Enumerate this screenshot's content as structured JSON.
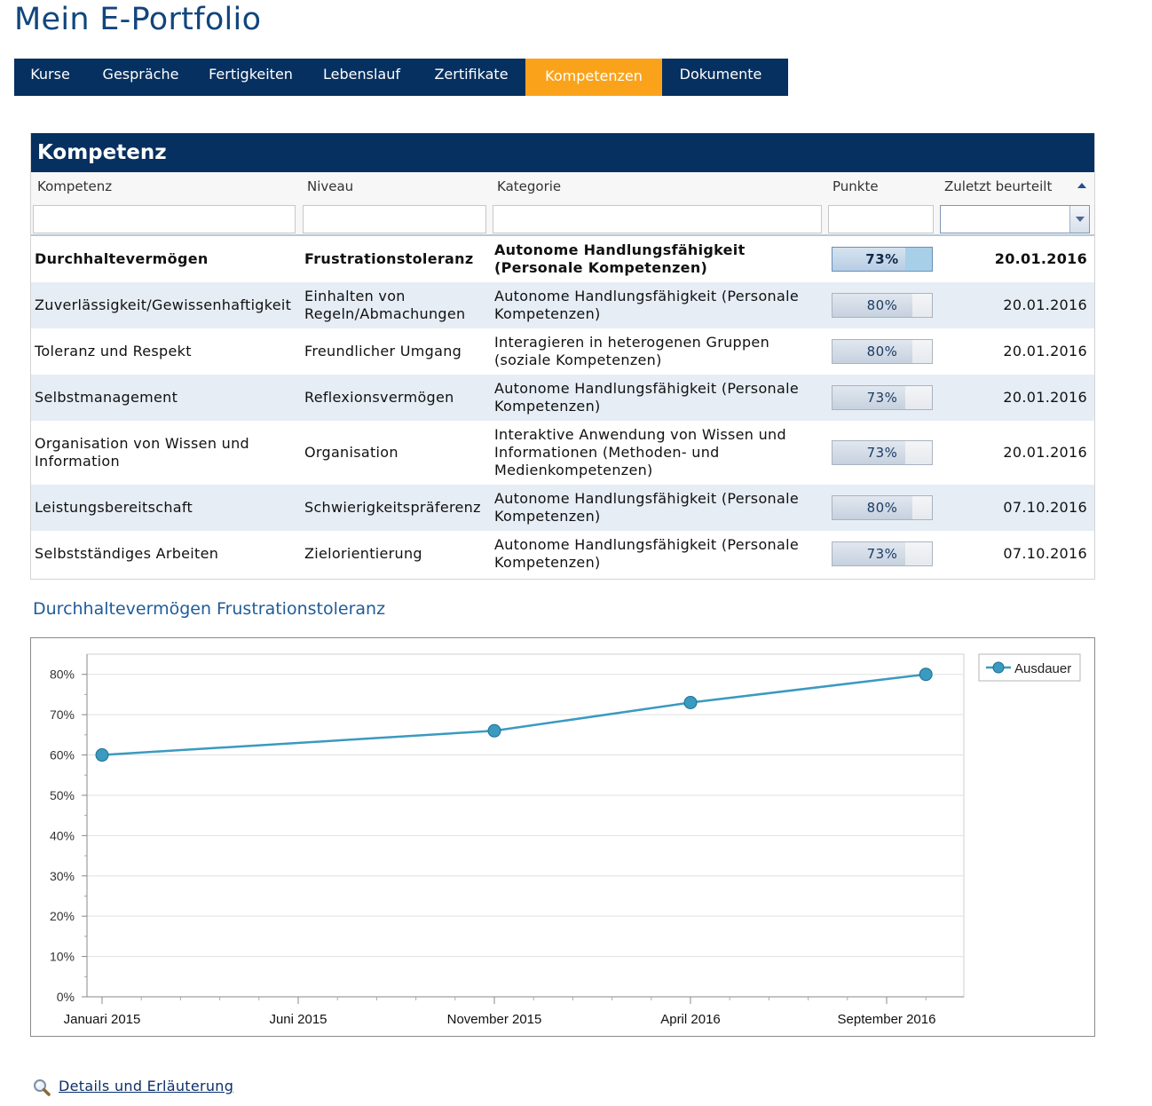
{
  "page": {
    "title": "Mein E-Portfolio"
  },
  "nav": {
    "tabs": [
      {
        "label": "Kurse",
        "active": false
      },
      {
        "label": "Gespräche",
        "active": false
      },
      {
        "label": "Fertigkeiten",
        "active": false
      },
      {
        "label": "Lebenslauf",
        "active": false
      },
      {
        "label": "Zertifikate",
        "active": false
      },
      {
        "label": "Kompetenzen",
        "active": true
      },
      {
        "label": "Dokumente",
        "active": false
      }
    ]
  },
  "grid": {
    "title": "Kompetenz",
    "columns": [
      "Kompetenz",
      "Niveau",
      "Kategorie",
      "Punkte",
      "Zuletzt beurteilt"
    ],
    "sort_column": "Zuletzt beurteilt",
    "sort_direction": "ascending",
    "filters": {
      "kompetenz": "",
      "niveau": "",
      "kategorie": "",
      "punkte": "",
      "datum": ""
    },
    "rows": [
      {
        "kompetenz": [
          "Durchhaltevermögen"
        ],
        "niveau": [
          "Frustrationstoleranz"
        ],
        "kategorie": [
          "Autonome Handlungsfähigkeit",
          "(Personale Kompetenzen)"
        ],
        "punkte": 73,
        "punkte_label": "73%",
        "datum": "20.01.2016",
        "selected": true
      },
      {
        "kompetenz": [
          "Zuverlässigkeit/Gewissenhaftigkeit"
        ],
        "niveau": [
          "Einhalten von",
          "Regeln/Abmachungen"
        ],
        "kategorie": [
          "Autonome Handlungsfähigkeit (Personale",
          "Kompetenzen)"
        ],
        "punkte": 80,
        "punkte_label": "80%",
        "datum": "20.01.2016",
        "selected": false
      },
      {
        "kompetenz": [
          "Toleranz und Respekt"
        ],
        "niveau": [
          "Freundlicher Umgang"
        ],
        "kategorie": [
          "Interagieren in heterogenen Gruppen",
          "(soziale Kompetenzen)"
        ],
        "punkte": 80,
        "punkte_label": "80%",
        "datum": "20.01.2016",
        "selected": false
      },
      {
        "kompetenz": [
          "Selbstmanagement"
        ],
        "niveau": [
          "Reflexionsvermögen"
        ],
        "kategorie": [
          "Autonome Handlungsfähigkeit (Personale",
          "Kompetenzen)"
        ],
        "punkte": 73,
        "punkte_label": "73%",
        "datum": "20.01.2016",
        "selected": false
      },
      {
        "kompetenz": [
          "Organisation von Wissen und",
          "Information"
        ],
        "niveau": [
          "Organisation"
        ],
        "kategorie": [
          "Interaktive Anwendung von Wissen und",
          "Informationen (Methoden- und",
          "Medienkompetenzen)"
        ],
        "punkte": 73,
        "punkte_label": "73%",
        "datum": "20.01.2016",
        "selected": false
      },
      {
        "kompetenz": [
          "Leistungsbereitschaft"
        ],
        "niveau": [
          "Schwierigkeitspräferenz"
        ],
        "kategorie": [
          "Autonome Handlungsfähigkeit (Personale",
          "Kompetenzen)"
        ],
        "punkte": 80,
        "punkte_label": "80%",
        "datum": "07.10.2016",
        "selected": false
      },
      {
        "kompetenz": [
          "Selbstständiges Arbeiten"
        ],
        "niveau": [
          "Zielorientierung"
        ],
        "kategorie": [
          "Autonome Handlungsfähigkeit (Personale",
          "Kompetenzen)"
        ],
        "punkte": 73,
        "punkte_label": "73%",
        "datum": "07.10.2016",
        "selected": false
      }
    ]
  },
  "chart_section": {
    "title": "Durchhaltevermögen Frustrationstoleranz"
  },
  "chart_data": {
    "type": "line",
    "title": "Durchhaltevermögen Frustrationstoleranz",
    "xlabel": "",
    "ylabel": "",
    "x_ticks": [
      "Januari 2015",
      "Juni 2015",
      "November 2015",
      "April 2016",
      "September 2016"
    ],
    "x_range": [
      "2015-01",
      "2016-10"
    ],
    "y_ticks": [
      "0%",
      "10%",
      "20%",
      "30%",
      "40%",
      "50%",
      "60%",
      "70%",
      "80%"
    ],
    "ylim": [
      0,
      85
    ],
    "grid": true,
    "legend": "top-right",
    "series": [
      {
        "name": "Ausdauer",
        "color": "#3a9ac0",
        "points": [
          {
            "x": "2015-01",
            "y": 60
          },
          {
            "x": "2015-11",
            "y": 66
          },
          {
            "x": "2016-04",
            "y": 73
          },
          {
            "x": "2016-10",
            "y": 80
          }
        ]
      }
    ]
  },
  "footer": {
    "details_link": "Details und Erläuterung",
    "icon": "magnifier-icon"
  }
}
